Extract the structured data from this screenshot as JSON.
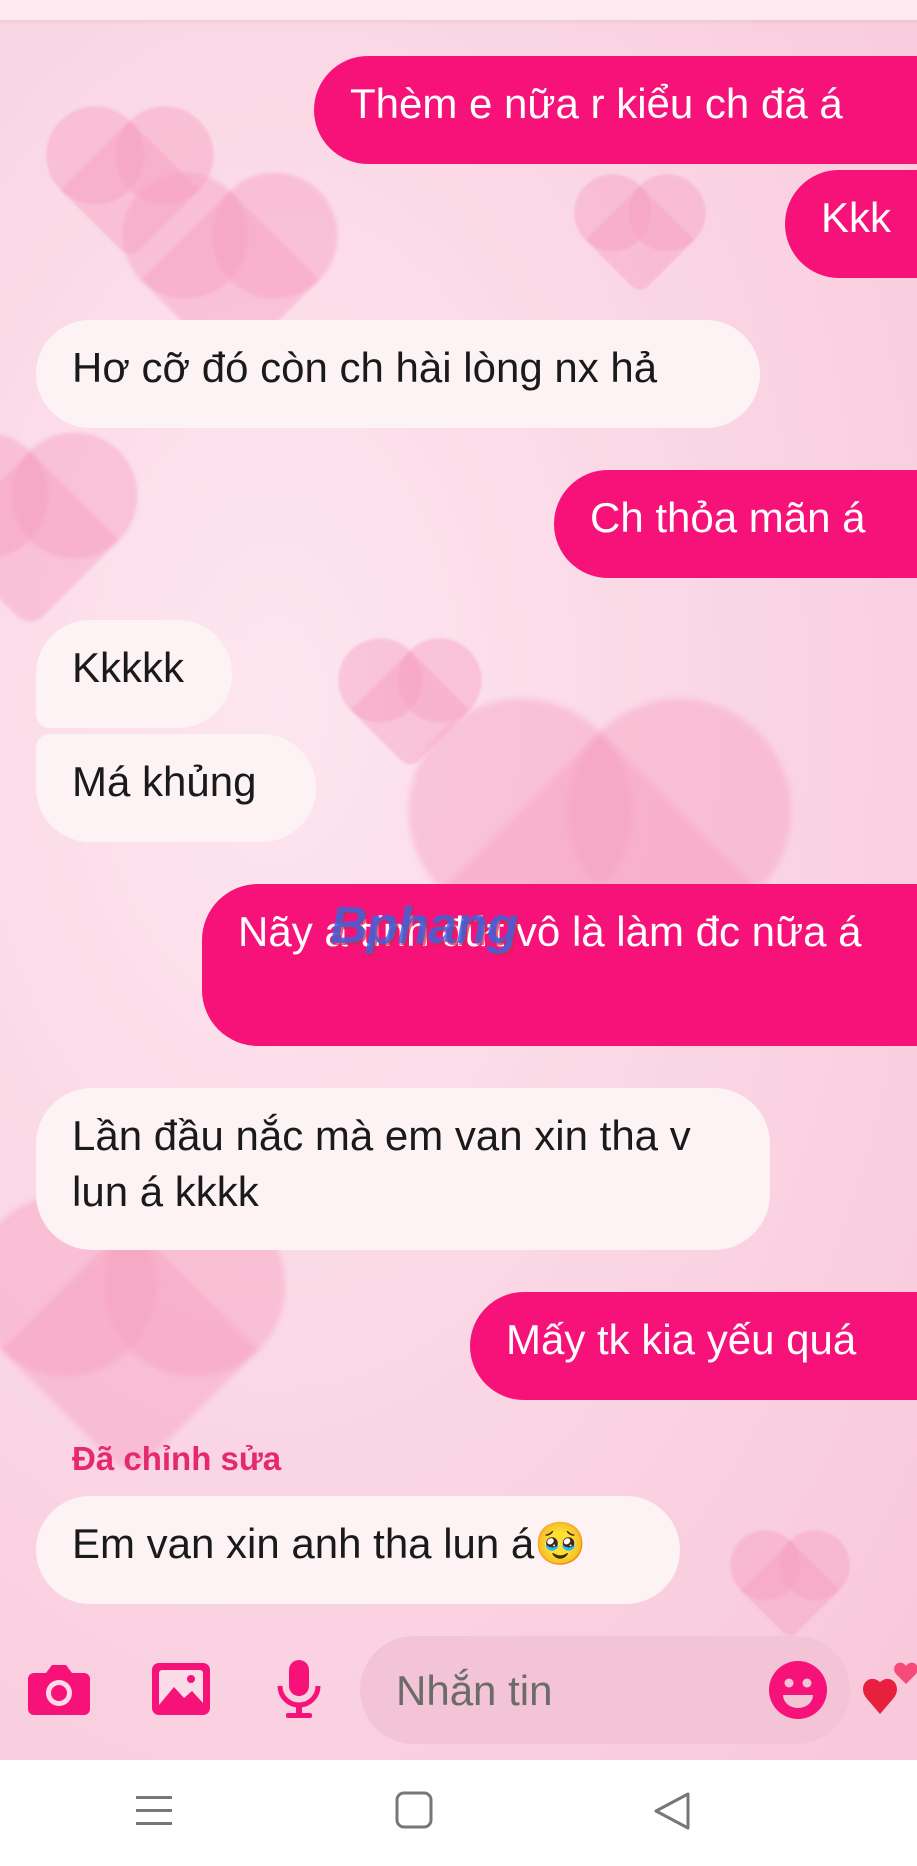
{
  "conversation": {
    "messages": [
      {
        "side": "out",
        "text": "Thèm e nữa r kiểu ch đã á"
      },
      {
        "side": "out",
        "text": "Kkk"
      },
      {
        "side": "in",
        "text": "Hơ cỡ đó còn ch hài lòng nx hả"
      },
      {
        "side": "out",
        "text": "Ch thỏa mãn á"
      },
      {
        "side": "in",
        "text": "Kkkkk"
      },
      {
        "side": "in",
        "text": "Má khủng"
      },
      {
        "side": "out",
        "text": "Nãy a tính đứt vô là làm đc nữa á"
      },
      {
        "side": "in",
        "text": "Lần đầu nắc mà em van xin tha v lun á kkkk"
      },
      {
        "side": "out",
        "text": "Mấy tk kia yếu quá"
      },
      {
        "side": "in",
        "edited_label": "Đã chỉnh sửa",
        "text": "Em van xin anh tha lun á🥹"
      }
    ]
  },
  "watermark": "Bphang",
  "composer": {
    "placeholder": "Nhắn tin",
    "icons": [
      "camera-icon",
      "gallery-icon",
      "microphone-icon",
      "emoji-icon",
      "heart-icon"
    ]
  },
  "navbar": {
    "icons": [
      "menu-icon",
      "home-icon",
      "back-icon"
    ]
  },
  "colors": {
    "accent": "#f7127a",
    "incoming_bubble": "#fdf3f5",
    "edited_label": "#e5296f",
    "input_bg": "#f2c4d6"
  }
}
